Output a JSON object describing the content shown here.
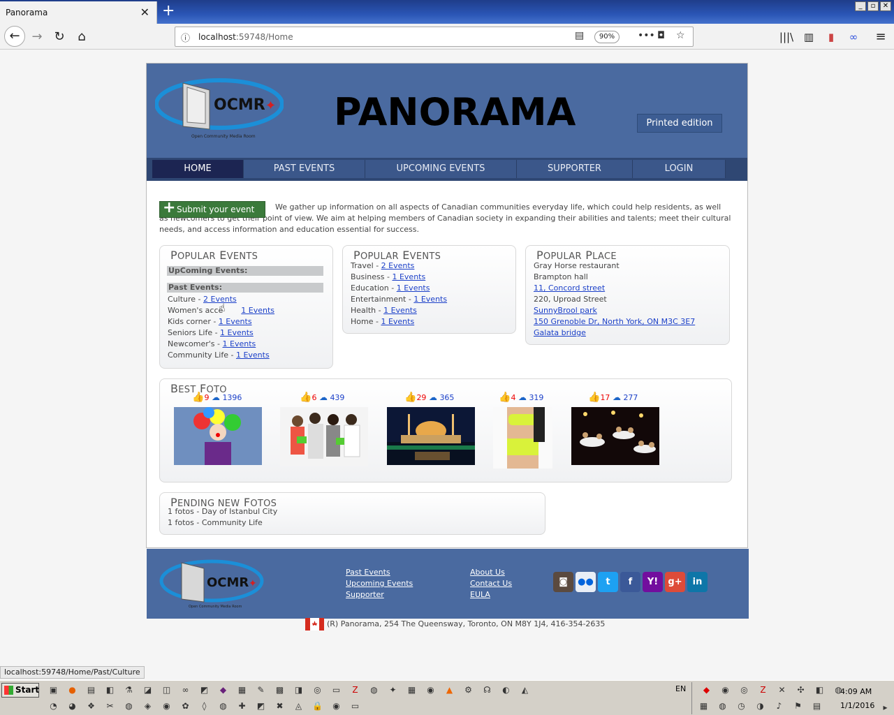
{
  "browser": {
    "tab_title": "Panorama",
    "tab_close": "✕",
    "new_tab": "+",
    "url_host": "localhost",
    "url_path": ":59748/Home",
    "zoom": "90%",
    "status_url": "localhost:59748/Home/Past/Culture"
  },
  "header": {
    "logo_text": "OCMR",
    "logo_sub": "Open Community Media Room",
    "title": "PANORAMA",
    "printed_edition": "Printed edition"
  },
  "menu": [
    "HOME",
    "PAST EVENTS",
    "UPCOMING EVENTS",
    "SUPPORTER",
    "LOGIN"
  ],
  "submit": {
    "label": "Submit your event",
    "intro": "We gather up information on all aspects of Canadian communities everyday life, which could help residents, as well as newcomers to get their point of view. We aim at helping members of Canadian society in expanding their abilities and talents; meet their cultural needs, and access information and education essential for success."
  },
  "popular_events_1": {
    "title_cap": "P",
    "title_rest": "OPULAR",
    "title_cap2": "E",
    "title_rest2": "VENTS",
    "upcoming_label": "UpComing Events:",
    "past_label": "Past Events:",
    "items": [
      {
        "name": "Culture - ",
        "link": "2 Events"
      },
      {
        "name": "Women's acce",
        "link": "1 Events"
      },
      {
        "name": "Kids corner - ",
        "link": "1 Events"
      },
      {
        "name": "Seniors Life - ",
        "link": "1 Events"
      },
      {
        "name": "Newcomer's - ",
        "link": "1 Events"
      },
      {
        "name": "Community Life - ",
        "link": "1 Events"
      }
    ]
  },
  "popular_events_2": {
    "title_cap": "P",
    "title_rest": "OPULAR",
    "title_cap2": "E",
    "title_rest2": "VENTS",
    "items": [
      {
        "name": "Travel - ",
        "link": "2 Events"
      },
      {
        "name": "Business - ",
        "link": "1 Events"
      },
      {
        "name": "Education - ",
        "link": "1 Events"
      },
      {
        "name": "Entertainment - ",
        "link": "1 Events"
      },
      {
        "name": "Health - ",
        "link": "1 Events"
      },
      {
        "name": "Home - ",
        "link": "1 Events"
      }
    ]
  },
  "popular_place": {
    "title_cap": "P",
    "title_rest": "OPULAR",
    "title_cap2": "P",
    "title_rest2": "LACE",
    "plain": [
      "Gray Horse restaurant",
      "Brampton hall"
    ],
    "links_1": [
      "11, Concord street"
    ],
    "plain_2": [
      "220, Uproad Street"
    ],
    "links_2": [
      "SunnyBrool park",
      "150 Grenoble Dr, North York, ON M3C 3E7",
      "Galata bridge"
    ]
  },
  "best_foto": {
    "title_cap": "B",
    "title_rest": "EST",
    "title_cap2": "F",
    "title_rest2": "OTO",
    "photos": [
      {
        "likes": "9",
        "views": "1396"
      },
      {
        "likes": "6",
        "views": "439"
      },
      {
        "likes": "29",
        "views": "365"
      },
      {
        "likes": "4",
        "views": "319"
      },
      {
        "likes": "17",
        "views": "277"
      }
    ]
  },
  "pending": {
    "title_cap": "P",
    "title_rest": "ENDING NEW",
    "title_cap2": "F",
    "title_rest2": "OTOS",
    "items": [
      "1 fotos - Day of Istanbul City",
      "1 fotos - Community Life"
    ]
  },
  "footer": {
    "col1": [
      "Past Events",
      "Upcoming Events",
      "Supporter"
    ],
    "col2": [
      "About Us",
      "Contact Us",
      "EULA"
    ],
    "social": [
      {
        "icon": "instagram-icon",
        "glyph": "◙",
        "color": "#5b4a3f"
      },
      {
        "icon": "flickr-icon",
        "glyph": "●●",
        "color": "#e9eef6"
      },
      {
        "icon": "twitter-icon",
        "glyph": "t",
        "color": "#1da1f2"
      },
      {
        "icon": "facebook-icon",
        "glyph": "f",
        "color": "#3b5998"
      },
      {
        "icon": "yahoo-icon",
        "glyph": "Y!",
        "color": "#720e9e"
      },
      {
        "icon": "google-plus-icon",
        "glyph": "g+",
        "color": "#dd4b39"
      },
      {
        "icon": "linkedin-icon",
        "glyph": "in",
        "color": "#0e76a8"
      }
    ],
    "copyright": "(R) Panorama, 254 The Queensway, Toronto, ON M8Y 1J4, 416-354-2635"
  },
  "taskbar": {
    "start": "Start",
    "lang": "EN",
    "time": "4:09 AM",
    "date": "1/1/2016"
  }
}
